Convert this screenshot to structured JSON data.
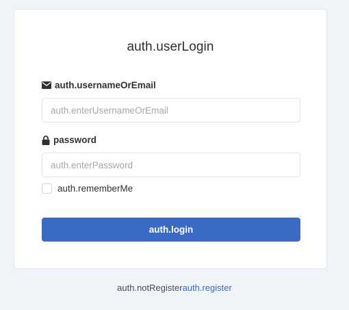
{
  "login": {
    "title": "auth.userLogin",
    "username_label": "auth.usernameOrEmail",
    "username_placeholder": "auth.enterUsernameOrEmail",
    "password_label": "password",
    "password_placeholder": "auth.enterPassword",
    "remember_label": "auth.rememberMe",
    "remember_checked": false,
    "login_button": "auth.login"
  },
  "footer": {
    "prompt": "auth.notRegister",
    "register_link": "auth.register"
  },
  "icons": {
    "username": "envelope-icon",
    "password": "lock-icon"
  },
  "colors": {
    "accent": "#3a6ac6",
    "background": "#f0f3f8",
    "card": "#ffffff"
  }
}
